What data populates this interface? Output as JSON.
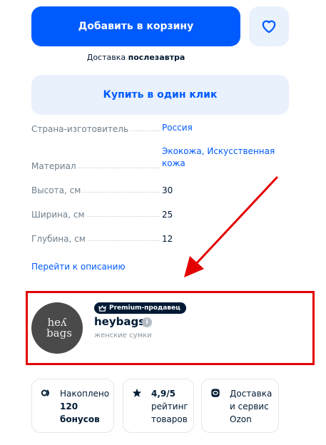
{
  "actions": {
    "add_to_cart": "Добавить в корзину",
    "delivery_prefix": "Доставка",
    "delivery_when": "послезавтра",
    "buy_one_click": "Купить в один клик"
  },
  "specs": [
    {
      "key": "Страна-изготовитель",
      "value": "Россия"
    },
    {
      "key": "Материал",
      "value": "Экокожа, Искусственная кожа"
    },
    {
      "key": "Высота, см",
      "value": "30"
    },
    {
      "key": "Ширина, см",
      "value": "25"
    },
    {
      "key": "Глубина, см",
      "value": "12"
    }
  ],
  "go_to_description": "Перейти к описанию",
  "seller": {
    "badge": "Premium-продавец",
    "name": "heybags",
    "subtitle": "женские сумки",
    "logo_line1": "heʎ",
    "logo_line2": "bags"
  },
  "chips": [
    {
      "icon": "bonus-icon",
      "line1": "Накоплено",
      "line2": "120",
      "line3": "бонусов"
    },
    {
      "icon": "star-icon",
      "line1": "4,9/5",
      "line2": "рейтинг",
      "line3": "товаров"
    },
    {
      "icon": "ozon-icon",
      "line1": "Доставка",
      "line2": "и сервис",
      "line3": "Ozon"
    }
  ],
  "colors": {
    "primary": "#005bff",
    "primary_light": "#e9f1fd",
    "highlight_red": "#e30000",
    "text": "#001a34",
    "muted": "#707f8d"
  }
}
